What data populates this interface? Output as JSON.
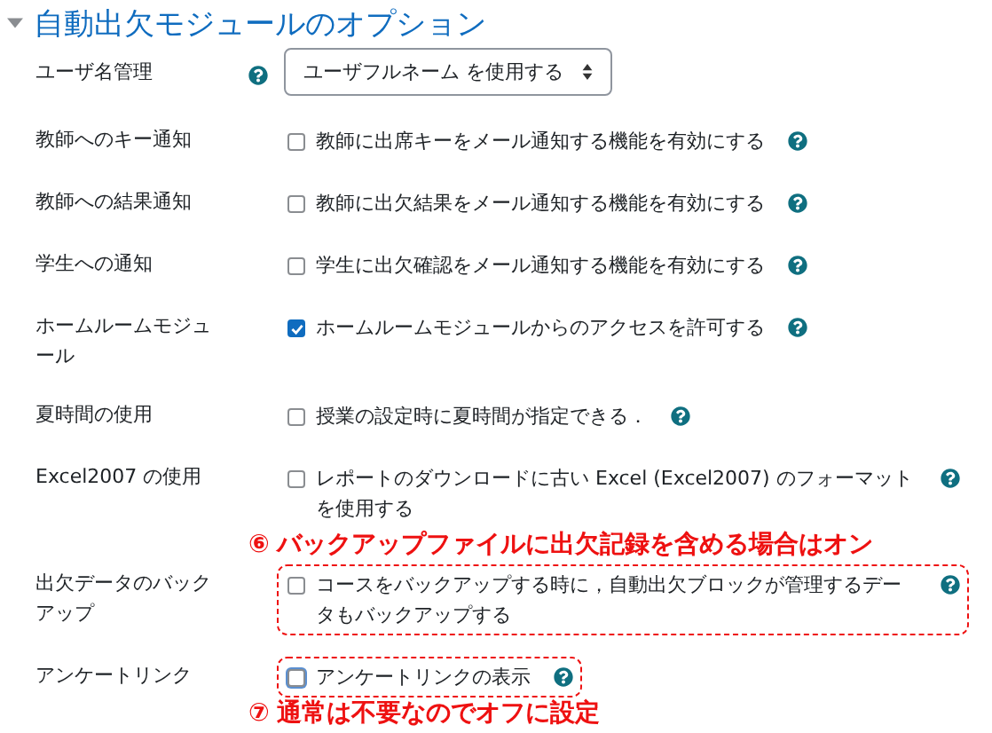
{
  "section": {
    "title": "自動出欠モジュールのオプション",
    "expanded": true
  },
  "rows": [
    {
      "kind": "select",
      "label": "ユーザ名管理",
      "value": "ユーザフルネーム を使用する",
      "highlighted": false
    },
    {
      "kind": "checkbox",
      "label": "教師へのキー通知",
      "text": "教師に出席キーをメール通知する機能を有効にする",
      "checked": false,
      "focused": false,
      "highlighted": false
    },
    {
      "kind": "checkbox",
      "label": "教師への結果通知",
      "text": "教師に出欠結果をメール通知する機能を有効にする",
      "checked": false,
      "focused": false,
      "highlighted": false
    },
    {
      "kind": "checkbox",
      "label": "学生への通知",
      "text": "学生に出欠確認をメール通知する機能を有効にする",
      "checked": false,
      "focused": false,
      "highlighted": false
    },
    {
      "kind": "checkbox",
      "label": "ホームルームモジュール",
      "text": "ホームルームモジュールからのアクセスを許可する",
      "checked": true,
      "focused": false,
      "highlighted": false
    },
    {
      "kind": "checkbox",
      "label": "夏時間の使用",
      "text": "授業の設定時に夏時間が指定できる．",
      "checked": false,
      "focused": false,
      "highlighted": false
    },
    {
      "kind": "checkbox",
      "label": "Excel2007 の使用",
      "text": "レポートのダウンロードに古い Excel (Excel2007) のフォーマットを使用する",
      "checked": false,
      "focused": false,
      "highlighted": false
    },
    {
      "kind": "note",
      "mark": "⑥",
      "text": "バックアップファイルに出欠記録を含める場合はオン"
    },
    {
      "kind": "checkbox",
      "label": "出欠データのバックアップ",
      "text": "コースをバックアップする時に，自動出欠ブロックが管理するデータもバックアップする",
      "checked": false,
      "focused": false,
      "highlighted": true
    },
    {
      "kind": "checkbox",
      "label": "アンケートリンク",
      "text": "アンケートリンクの表示",
      "checked": false,
      "focused": true,
      "highlighted": true
    },
    {
      "kind": "note",
      "mark": "⑦",
      "text": "通常は不要なのでオフに設定"
    }
  ]
}
